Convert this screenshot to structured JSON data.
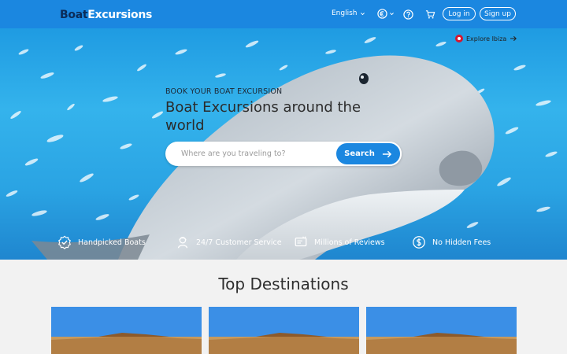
{
  "header": {
    "logo_part1": "Boat",
    "logo_part2": "Excursions",
    "language": "English",
    "currency_icon": "euro-circle-icon",
    "help_icon": "question-circle-icon",
    "cart_icon": "cart-icon",
    "login_label": "Log in",
    "signup_label": "Sign up"
  },
  "hero": {
    "explore_label": "Explore Ibiza",
    "eyebrow": "BOOK YOUR BOAT EXCURSION",
    "headline": "Boat Excursions around the world",
    "search": {
      "placeholder": "Where are you traveling to?",
      "button_label": "Search"
    },
    "features": [
      {
        "label": "Handpicked Boats",
        "icon": "badge-check-icon"
      },
      {
        "label": "24/7 Customer Service",
        "icon": "support-agent-icon"
      },
      {
        "label": "Millions of Reviews",
        "icon": "reviews-icon"
      },
      {
        "label": "No Hidden Fees",
        "icon": "dollar-circle-icon"
      }
    ]
  },
  "destinations": {
    "title": "Top Destinations",
    "cards": [
      {
        "image": "desert-landscape"
      },
      {
        "image": "desert-landscape"
      },
      {
        "image": "desert-landscape"
      }
    ]
  },
  "colors": {
    "brand_blue": "#1b87e0",
    "logo_navy": "#0b2b57",
    "page_bg": "#f2f2f2",
    "explore_pin": "#d6162f"
  }
}
